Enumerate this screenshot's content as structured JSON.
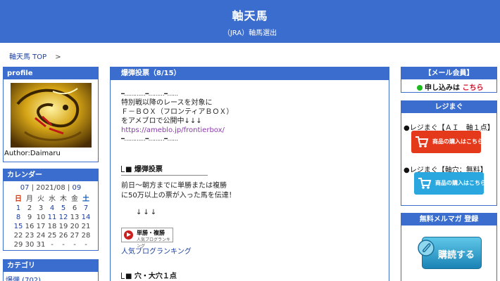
{
  "header": {
    "title": "軸天馬",
    "subtitle": "（JRA）軸馬選出"
  },
  "breadcrumb": {
    "home": "軸天馬 TOP",
    "separator": ">"
  },
  "profile": {
    "heading": "profile",
    "author": "Author:Daimaru",
    "image_icon": "golden-dragon-image"
  },
  "calendar": {
    "heading": "カレンダー",
    "prev_month": "07",
    "current": "2021/08",
    "next_month": "09",
    "nav_separator": "|",
    "weekdays": [
      "日",
      "月",
      "火",
      "水",
      "木",
      "金",
      "土"
    ],
    "weeks": [
      [
        "1",
        "2",
        "3",
        "4",
        "5",
        "6",
        "7"
      ],
      [
        "8",
        "9",
        "10",
        "11",
        "12",
        "13",
        "14"
      ],
      [
        "15",
        "16",
        "17",
        "18",
        "19",
        "20",
        "21"
      ],
      [
        "22",
        "23",
        "24",
        "25",
        "26",
        "27",
        "28"
      ],
      [
        "29",
        "30",
        "31",
        "-",
        "-",
        "-",
        "-"
      ]
    ]
  },
  "category": {
    "heading": "カテゴリ",
    "first_item": "爆弾 (702)"
  },
  "main": {
    "heading": "爆弾投票（8/15）",
    "dot_line_1": "━…………━………━……",
    "intro_lines": [
      "特別戦以降のレースを対象に",
      "Ｆ－ＢＯＸ（フロンティアＢＯＸ）",
      "をアメブロで公開中↓↓↓"
    ],
    "intro_link": "https://ameblo.jp/frontierbox/",
    "dot_line_2": "━…………━………━……",
    "section1_title": "■ 爆弾投票",
    "section1_lines": [
      "前日～朝方までに単勝または複勝",
      "に50万以上の票が入った馬を伝達！"
    ],
    "arrows": "↓↓↓",
    "ranking_banner_title": "単勝・複勝",
    "ranking_banner_sub": "人気ブログランキング",
    "ranking_link": "人気ブログランキング",
    "section2_title": "■ 穴・大穴１点"
  },
  "sidebar_right": {
    "mail": {
      "heading": "【メール会員】",
      "apply_text": "申し込みは",
      "apply_link": "こちら"
    },
    "regi": {
      "heading": "レジまぐ",
      "line1": "●レジまぐ【ＡＩ　軸１点】",
      "line2": "●レジまぐ【軸穴：無料】",
      "buy_button_label": "商品の購入はこちら",
      "buy_button_2_label": "商品の購入はこちら",
      "button1_color": "#e5391b",
      "button2_color": "#2aa7de"
    },
    "merumaga": {
      "heading": "無料メルマガ 登録",
      "subscribe_label": "購読する"
    }
  },
  "colors": {
    "accent": "#3a6dce",
    "link": "#1a3fa0",
    "sunday": "#d03a10",
    "saturday": "#1a5fc0"
  }
}
